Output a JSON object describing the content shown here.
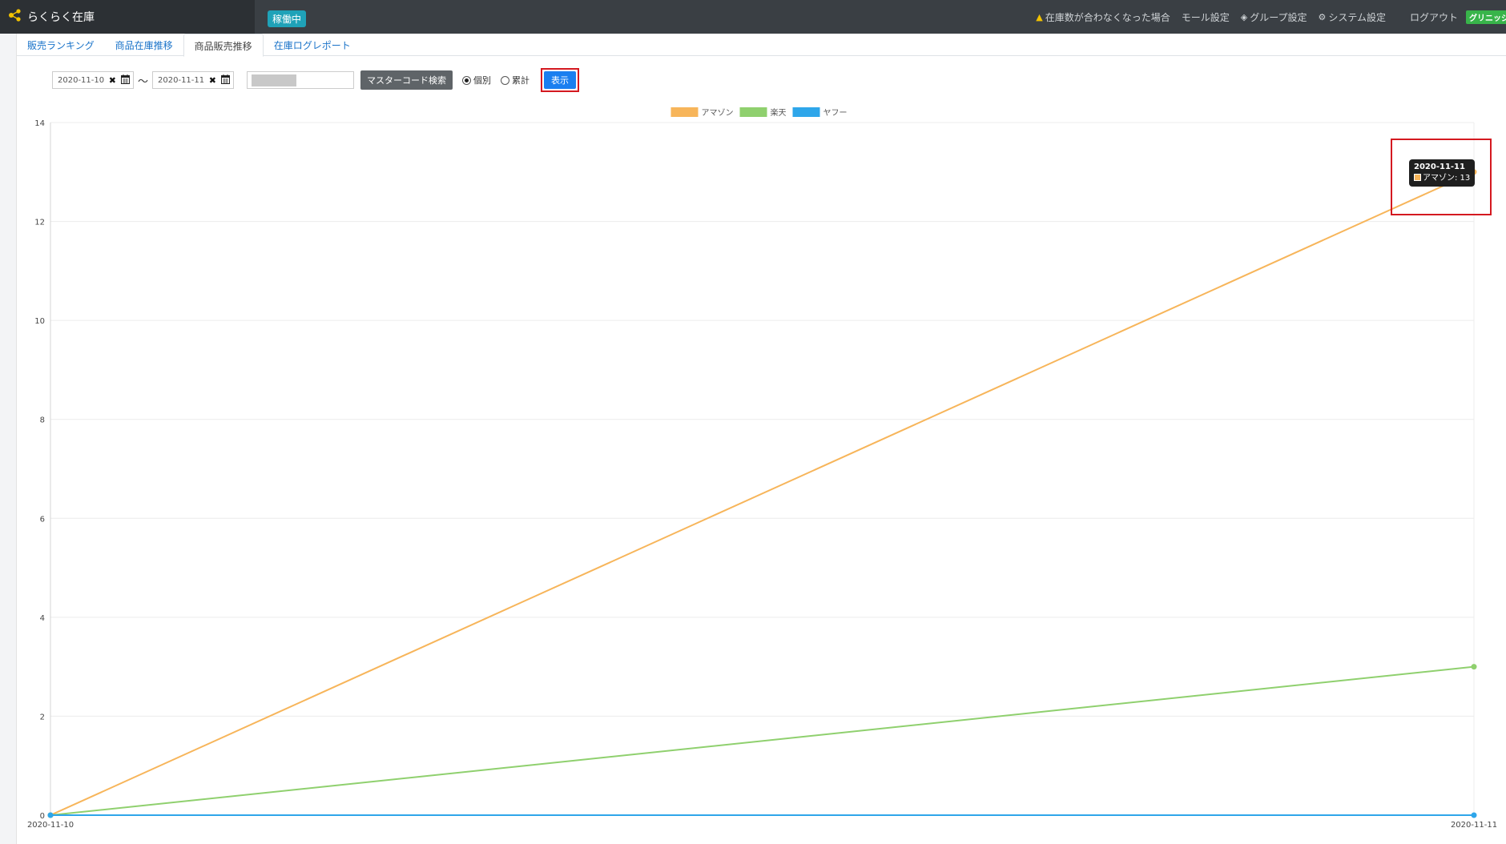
{
  "app": {
    "title": "らくらく在庫",
    "status_badge": "稼働中"
  },
  "topnav": {
    "warning_label": "在庫数が合わなくなった場合",
    "mall_label": "モール設定",
    "group_label": "グループ設定",
    "system_label": "システム設定",
    "logout_label": "ログアウト",
    "user_badge": "グリニッジ"
  },
  "tabs": [
    {
      "label": "販売ランキング",
      "active": false
    },
    {
      "label": "商品在庫推移",
      "active": false
    },
    {
      "label": "商品販売推移",
      "active": true
    },
    {
      "label": "在庫ログレポート",
      "active": false
    }
  ],
  "controls": {
    "date_from": "2020-11-10",
    "date_to": "2020-11-11",
    "range_sep": "～",
    "search_button": "マスターコード検索",
    "radio_individual": "個別",
    "radio_cumulative": "累計",
    "show_button": "表示"
  },
  "tooltip": {
    "date": "2020-11-11",
    "text": "アマゾン: 13"
  },
  "colors": {
    "amazon": "#f7b55a",
    "rakuten": "#8fd06e",
    "yahoo": "#2ea6ea",
    "highlight": "#d41920"
  },
  "chart_data": {
    "type": "line",
    "categories": [
      "2020-11-10",
      "2020-11-11"
    ],
    "series": [
      {
        "name": "アマゾン",
        "values": [
          0,
          13
        ],
        "color": "#f7b55a"
      },
      {
        "name": "楽天",
        "values": [
          0,
          3
        ],
        "color": "#8fd06e"
      },
      {
        "name": "ヤフー",
        "values": [
          0,
          0
        ],
        "color": "#2ea6ea"
      }
    ],
    "ylim": [
      0,
      14
    ],
    "yticks": [
      0,
      2,
      4,
      6,
      8,
      10,
      12,
      14
    ],
    "grid": true,
    "legend": "top-center"
  }
}
